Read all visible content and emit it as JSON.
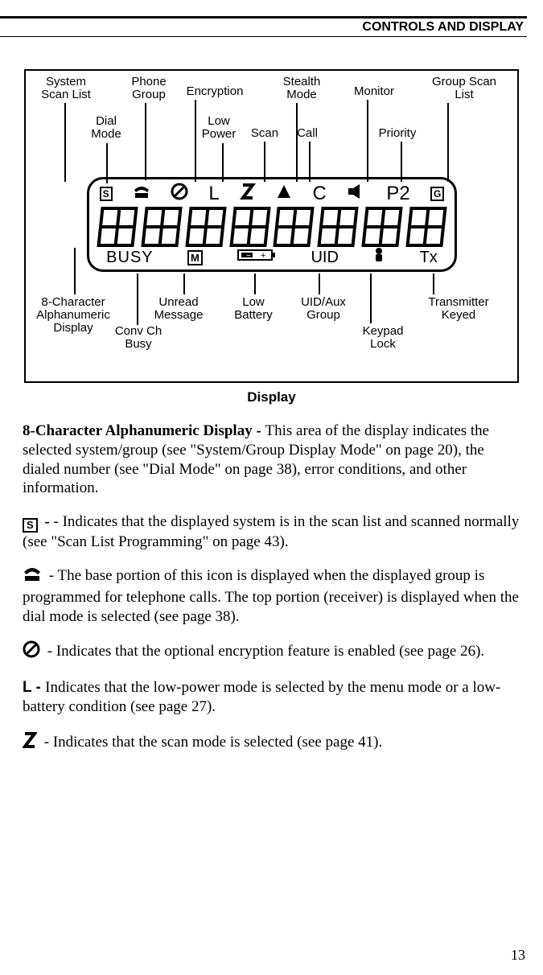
{
  "header": {
    "section_title": "CONTROLS AND DISPLAY"
  },
  "figure": {
    "caption": "Display",
    "labels": {
      "sys_scan": "System\nScan List",
      "dial_mode": "Dial\nMode",
      "phone_group": "Phone\nGroup",
      "encryption": "Encryption",
      "low_power": "Low\nPower",
      "stealth": "Stealth\nMode",
      "scan": "Scan",
      "call": "Call",
      "monitor": "Monitor",
      "priority": "Priority",
      "group_scan": "Group Scan\nList",
      "alnum": "8-Character\nAlphanumeric\nDisplay",
      "conv_busy": "Conv Ch\nBusy",
      "unread": "Unread\nMessage",
      "low_batt": "Low\nBattery",
      "uid_aux": "UID/Aux\nGroup",
      "keypad_lock": "Keypad\nLock",
      "tx_keyed": "Transmitter\nKeyed"
    },
    "lcd_top": {
      "s": "S",
      "L": "L",
      "C": "C",
      "P2": "P2",
      "G": "G"
    },
    "lcd_bottom": {
      "busy": "BUSY",
      "M": "M",
      "uid": "UID",
      "tx": "Tx"
    }
  },
  "body": {
    "p1_bold": "8-Character Alphanumeric Display - ",
    "p1_rest": "This area of the display indicates the selected system/group (see \"System/Group Display Mode\" on page 20), the dialed number (see \"Dial Mode\" on page 38), error conditions, and other information.",
    "p2_icon": "S",
    "p2_rest": " - Indicates that the displayed system is in the scan list and scanned normally (see \"Scan List Programming\" on page 43).",
    "p3_rest": " - The base portion of this icon is displayed when the displayed group is programmed for telephone calls. The top portion (receiver) is displayed when the dial mode is selected (see page 38).",
    "p4_rest": " - Indicates that the optional encryption feature is enabled (see page 26).",
    "p5_icon": "L",
    "p5_bold": "L - ",
    "p5_rest": "Indicates that the low-power mode is selected by the menu mode or a low-battery condition (see page 27).",
    "p6_rest": " - Indicates that the scan mode is selected (see page 41)."
  },
  "page_number": "13"
}
